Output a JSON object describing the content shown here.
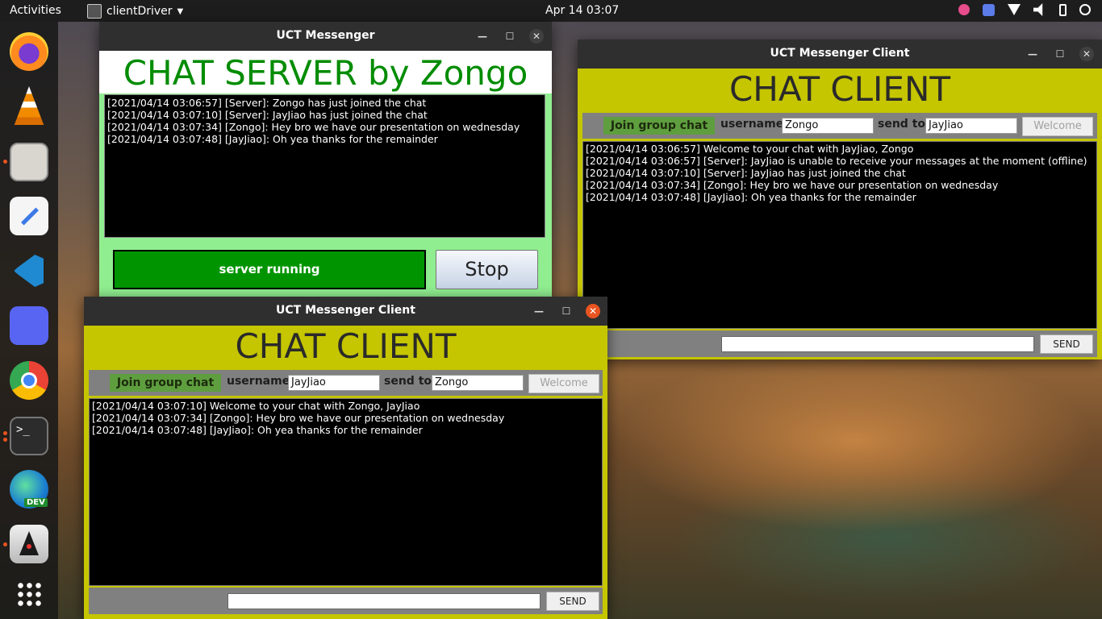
{
  "topbar": {
    "activities": "Activities",
    "app_name": "clientDriver",
    "clock": "Apr 14  03:07"
  },
  "dock": {
    "items": [
      "firefox-icon",
      "vlc-icon",
      "files-icon",
      "text-editor-icon",
      "vscode-icon",
      "discord-icon",
      "chrome-icon",
      "terminal-icon",
      "edge-dev-icon",
      "java-icon",
      "app-grid-icon"
    ],
    "edge_badge": "DEV"
  },
  "server_window": {
    "title": "UCT Messenger",
    "heading": "CHAT SERVER by Zongo",
    "log": [
      "[2021/04/14 03:06:57] [Server]: Zongo has just joined the chat",
      "[2021/04/14 03:07:10] [Server]: JayJiao has just joined the chat",
      "[2021/04/14 03:07:34]  [Zongo]: Hey bro we have our presentation on wednesday",
      "[2021/04/14 03:07:48]  [JayJiao]: Oh yea thanks for the remainder"
    ],
    "status": "server running",
    "stop_label": "Stop"
  },
  "client_right": {
    "title": "UCT Messenger Client",
    "heading": "CHAT CLIENT",
    "join_label": "Join group chat",
    "username_label": "username",
    "username_value": "Zongo",
    "sendto_label": "send to",
    "sendto_value": "JayJiao",
    "welcome_label": "Welcome",
    "send_label": "SEND",
    "log": [
      "[2021/04/14 03:06:57] Welcome to your chat with JayJiao, Zongo",
      "[2021/04/14 03:06:57]  [Server]: JayJiao is unable to receive your messages at the moment (offline)",
      "[2021/04/14 03:07:10]  [Server]: JayJiao has just joined the chat",
      "[2021/04/14 03:07:34]  [Zongo]: Hey bro we have our presentation on wednesday",
      "[2021/04/14 03:07:48]  [JayJiao]: Oh yea thanks for the remainder"
    ]
  },
  "client_left": {
    "title": "UCT Messenger Client",
    "heading": "CHAT CLIENT",
    "join_label": "Join group chat",
    "username_label": "username",
    "username_value": "JayJiao",
    "sendto_label": "send to",
    "sendto_value": "Zongo",
    "welcome_label": "Welcome",
    "send_label": "SEND",
    "log": [
      "[2021/04/14 03:07:10] Welcome to your chat with Zongo, JayJiao",
      "[2021/04/14 03:07:34]  [Zongo]: Hey bro we have our presentation on wednesday",
      "[2021/04/14 03:07:48]  [JayJiao]: Oh yea thanks for the remainder"
    ]
  },
  "colors": {
    "server_heading": "#008c00",
    "server_bg": "#90ee90",
    "client_bg": "#c5c500",
    "join_button": "#5e9e3e",
    "status_bg": "#009500",
    "close_active": "#e95420"
  }
}
